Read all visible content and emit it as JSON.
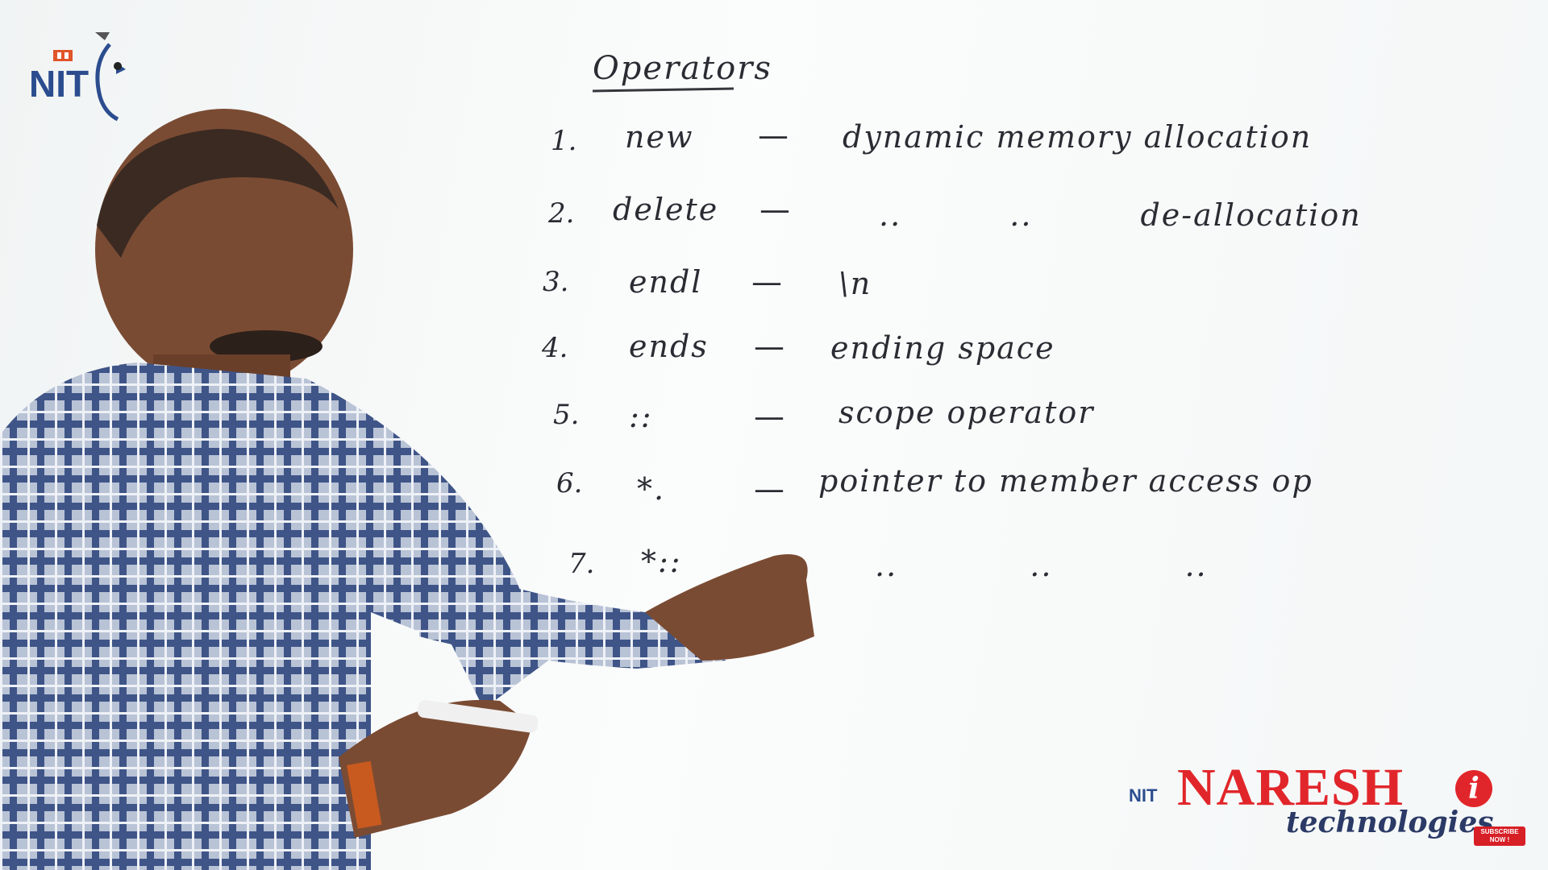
{
  "board": {
    "title": "Operators",
    "rows": [
      {
        "num": "1.",
        "op": "new",
        "dash": "—",
        "desc": "dynamic memory allocation"
      },
      {
        "num": "2.",
        "op": "delete",
        "dash": "—",
        "desc": ".. .. de-allocation"
      },
      {
        "num": "3.",
        "op": "endl",
        "dash": "—",
        "desc": "\\n"
      },
      {
        "num": "4.",
        "op": "ends",
        "dash": "—",
        "desc": "ending space"
      },
      {
        "num": "5.",
        "op": "::",
        "dash": "—",
        "desc": "scope operator"
      },
      {
        "num": "6.",
        "op": "*.",
        "dash": "—",
        "desc": "pointer to member access op"
      },
      {
        "num": "7.",
        "op": "*::",
        "dash": "—",
        "desc": ".. .. .."
      }
    ]
  },
  "logo_top_left": {
    "text": "NIT"
  },
  "brand": {
    "mini": "NIT",
    "name": "NARESH",
    "i": "i",
    "sub": "technologies"
  },
  "subscribe": {
    "line1": "SUBSCRIBE",
    "line2": "NOW !"
  },
  "colors": {
    "brand_red": "#e1262b",
    "brand_navy": "#2b3a66",
    "ink": "#2a2c33",
    "board": "#f6f8f8"
  }
}
